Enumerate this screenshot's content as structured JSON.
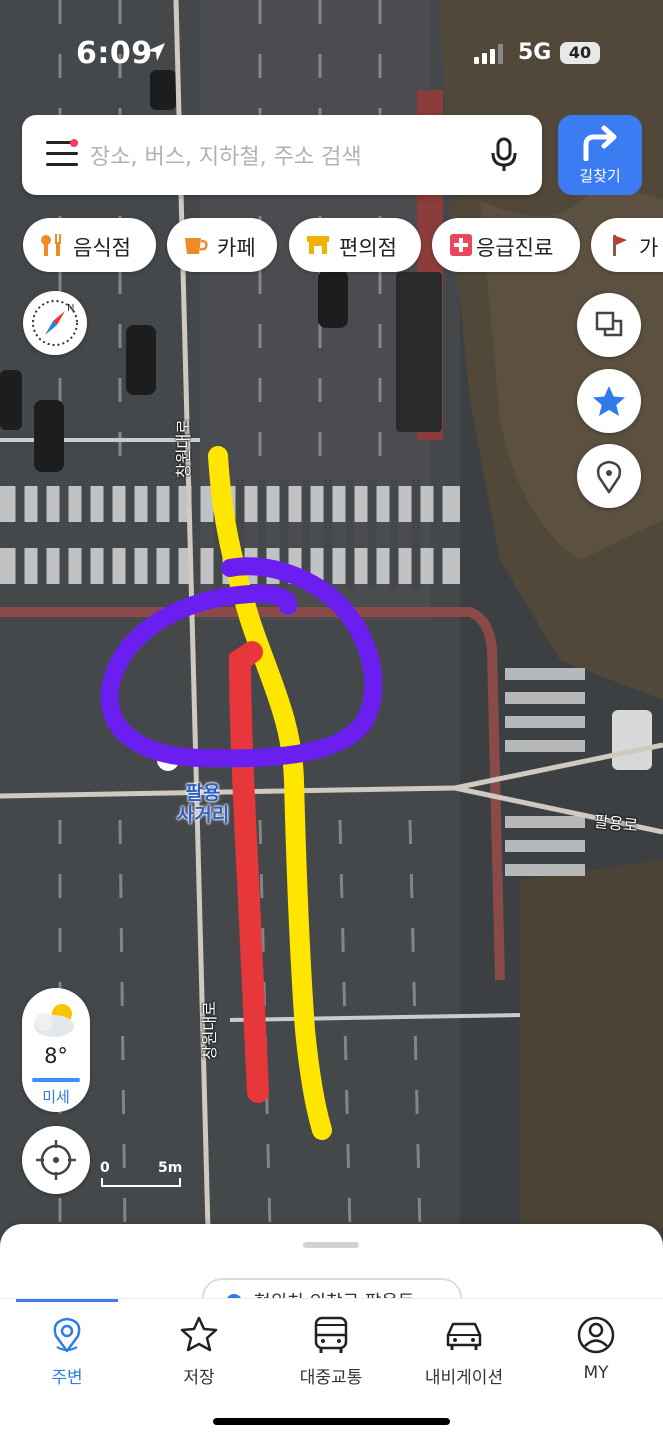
{
  "status_bar": {
    "time": "6:09",
    "network": "5G",
    "battery": "40"
  },
  "search": {
    "placeholder": "장소, 버스, 지하철, 주소 검색",
    "route_label": "길찾기"
  },
  "categories": [
    {
      "label": "음식점",
      "icon": "restaurant-icon"
    },
    {
      "label": "카페",
      "icon": "cafe-icon"
    },
    {
      "label": "편의점",
      "icon": "convenience-store-icon"
    },
    {
      "label": "응급진료",
      "icon": "emergency-icon"
    },
    {
      "label": "가",
      "icon": "flag-icon"
    }
  ],
  "map": {
    "road_label_1": "창원대로",
    "road_label_2": "창원대로",
    "road_label_3": "팔용로",
    "poi_name": "팔용\n사거리",
    "scale_zero": "0",
    "scale_max": "5m",
    "annotation_colors": {
      "yellow": "#ffe600",
      "red": "#e8373a",
      "purple": "#6a1ff0"
    }
  },
  "weather": {
    "temperature": "8°",
    "air_quality": "미세"
  },
  "sheet": {
    "chip_text": "현위치 의창구 팔용동"
  },
  "tabs": [
    {
      "label": "주변",
      "icon": "nearby-pin-icon",
      "active": true
    },
    {
      "label": "저장",
      "icon": "star-icon",
      "active": false
    },
    {
      "label": "대중교통",
      "icon": "bus-icon",
      "active": false
    },
    {
      "label": "내비게이션",
      "icon": "car-icon",
      "active": false
    },
    {
      "label": "MY",
      "icon": "profile-icon",
      "active": false
    }
  ]
}
